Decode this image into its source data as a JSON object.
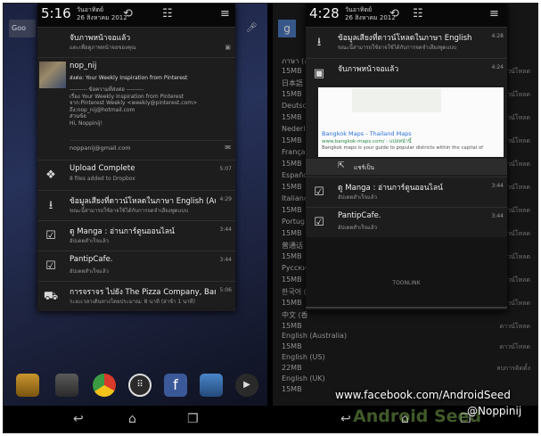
{
  "left": {
    "status": {
      "time": "5:16",
      "day": "วันอาทิตย์",
      "date": "26 สิงหาคม 2012"
    },
    "partial_tl": "Goo",
    "notifications": [
      {
        "title": "จับภาพหน้าจอแล้ว",
        "subtitle": "แตะเพื่อดูภาพหน้าจอของคุณ",
        "icon": "image-icon"
      },
      {
        "title": "nop_nij",
        "subtitle": "ส่งต่อ: Your Weekly Inspiration from Pinterest",
        "lines": [
          "--------- ข้อความที่ส่งต่อ ---------",
          "เรื่อง Your Weekly Inspiration from Pinterest",
          "จาก:Pinterest Weekly <weekly@pinterest.com>",
          "ถึง:nop_nij@hotmail.com",
          "ส่วนข้อ",
          "Hi, Noppinij!"
        ],
        "account": "noppanij@gmail.com"
      },
      {
        "title": "Upload Complete",
        "subtitle": "8 files added to Dropbox",
        "time": "5:07",
        "icon": "dropbox-icon"
      },
      {
        "title": "ข้อมูลเสียงที่ดาวน์โหลดในภาษา English (Au",
        "subtitle": "ขณะนี้สามารถใช้อาจใช้ได้กับการจดจำเสียงพูดแบบ",
        "time": "4:29",
        "icon": "download-icon"
      },
      {
        "title": "ดู Manga : อ่านการ์ตูนออนไลน์",
        "subtitle": "อัปเดตสำเร็จแล้ว",
        "time": "3:44",
        "icon": "bag-icon"
      },
      {
        "title": "PantipCafe.",
        "subtitle": "อัปเดตสำเร็จแล้ว",
        "time": "3:44",
        "icon": "bag-icon"
      },
      {
        "title": "การจราจร ไปยัง The Pizza Company, Bang",
        "subtitle": "ระยะเวลาเดินทางโดยประมาณ: 8 นาที (ล่าช้า 1 นาที)",
        "time": "5:06",
        "icon": "car-icon"
      }
    ]
  },
  "right": {
    "status": {
      "time": "4:28",
      "day": "วันอาทิตย์",
      "date": "26 สิงหาคม 2012"
    },
    "notifications": [
      {
        "title": "ข้อมูลเสียงที่ดาวน์โหลดในภาษา English",
        "subtitle": "ขณะนี้สามารถใช้อาจใช้ได้กับการจดจำเสียงพูดแบบ",
        "time": "4:28",
        "icon": "download-icon"
      },
      {
        "title": "จับภาพหน้าจอแล้ว",
        "time": "4:24",
        "icon": "image-icon"
      },
      {
        "title": "ดู Manga : อ่านการ์ตูนออนไลน์",
        "subtitle": "อัปเดตสำเร็จแล้ว",
        "time": "3:44",
        "icon": "bag-icon"
      },
      {
        "title": "PantipCafe.",
        "subtitle": "อัปเดตสำเร็จแล้ว",
        "time": "3:44",
        "icon": "bag-icon"
      }
    ],
    "maps": {
      "title": "Bangkok Maps - Thailand Maps",
      "url": "www.bangkok-maps.com/ - แปลหน้านี้",
      "desc": "Bangkok maps is your guide to popular districts within the capital of",
      "share": "แชร์เป็น"
    },
    "footer": "TOONLINK",
    "bg_list": [
      {
        "label": "ภาษา (อ",
        "right": ""
      },
      {
        "label": "15MB",
        "right": "ดาวน์โหลด"
      },
      {
        "label": "日本語",
        "right": ""
      },
      {
        "label": "15MB",
        "right": "ดาวน์โหลด"
      },
      {
        "label": "Deutsch",
        "right": ""
      },
      {
        "label": "15MB",
        "right": "ดาวน์โหลด"
      },
      {
        "label": "Nederl",
        "right": ""
      },
      {
        "label": "15MB",
        "right": "ดาวน์โหลด"
      },
      {
        "label": "Françai",
        "right": ""
      },
      {
        "label": "15MB",
        "right": "ดาวน์โหลด"
      },
      {
        "label": "Españo",
        "right": ""
      },
      {
        "label": "15MB",
        "right": "ดาวน์โหลด"
      },
      {
        "label": "Italiano",
        "right": ""
      },
      {
        "label": "15MB",
        "right": "ดาวน์โหลด"
      },
      {
        "label": "Portug",
        "right": ""
      },
      {
        "label": "15MB",
        "right": "ดาวน์โหลด"
      },
      {
        "label": "普通话 (",
        "right": ""
      },
      {
        "label": "15MB",
        "right": "ดาวน์โหลด"
      },
      {
        "label": "Русский",
        "right": ""
      },
      {
        "label": "15MB",
        "right": "ดาวน์โหลด"
      },
      {
        "label": "한국어 (",
        "right": ""
      },
      {
        "label": "15MB",
        "right": "ดาวน์โหลด"
      },
      {
        "label": "中文 (香",
        "right": ""
      },
      {
        "label": "15MB",
        "right": "ดาวน์โหลด"
      },
      {
        "label": "English (Australia)",
        "right": ""
      },
      {
        "label": "15MB",
        "right": "ดาวน์โหลด"
      },
      {
        "label": "English (US)",
        "right": ""
      },
      {
        "label": "22MB",
        "right": "ลบการติดตั้ง"
      },
      {
        "label": "English (UK)",
        "right": ""
      },
      {
        "label": "15MB",
        "right": ""
      }
    ]
  },
  "watermark": {
    "facebook": "www.facebook.com/AndroidSeed",
    "handle": "@Noppinij",
    "logo": "Android Seed"
  },
  "colors": {
    "shade": "#101010",
    "card": "#1d1d1d",
    "accent_blue": "#33b5e5",
    "watermark_green": "#8fc55d"
  }
}
